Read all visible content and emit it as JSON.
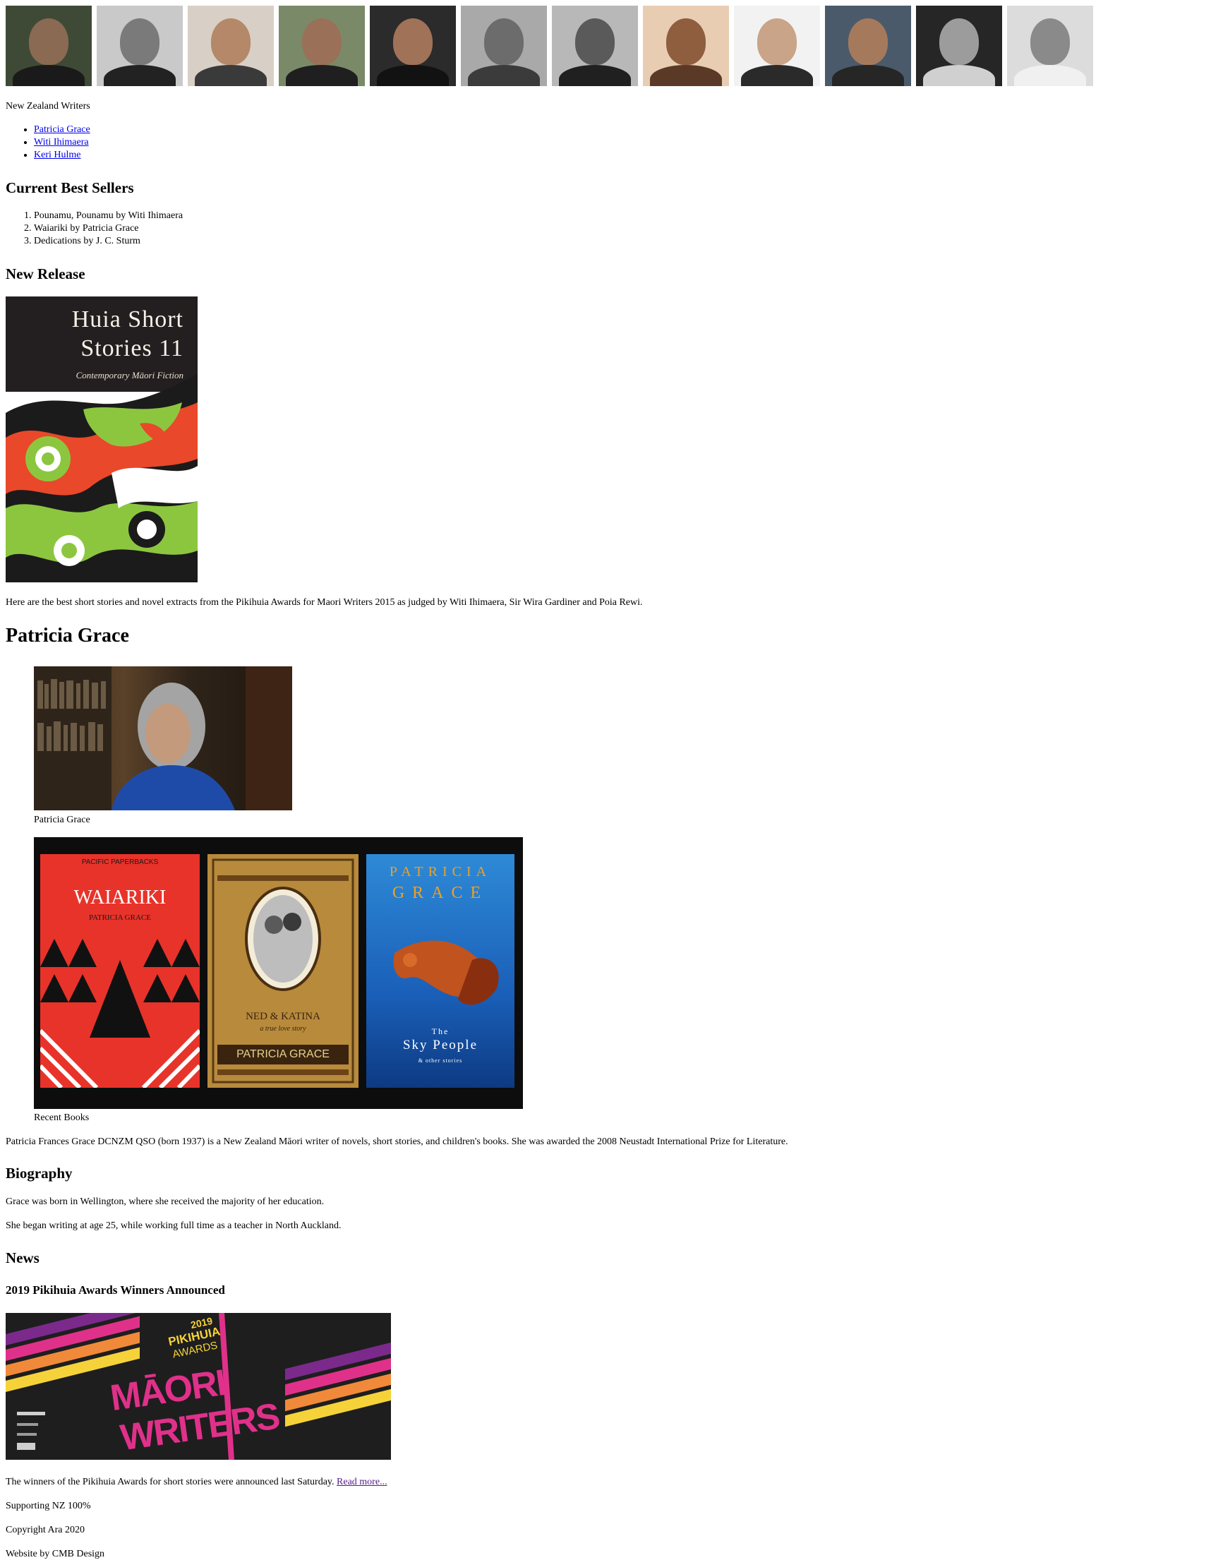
{
  "header": {
    "portraits": [
      {
        "name": "portrait-1",
        "bg": "#3f4a36",
        "skin": "#8a6a52",
        "cloth": "#1a1a1a"
      },
      {
        "name": "portrait-2",
        "bg": "#c9c9c9",
        "skin": "#7a7a7a",
        "cloth": "#222222"
      },
      {
        "name": "portrait-3",
        "bg": "#d8cfc6",
        "skin": "#b48868",
        "cloth": "#3a3a3a"
      },
      {
        "name": "portrait-4",
        "bg": "#7a8a68",
        "skin": "#9a7058",
        "cloth": "#1f1f1f"
      },
      {
        "name": "portrait-5",
        "bg": "#2b2b2b",
        "skin": "#a07258",
        "cloth": "#121212"
      },
      {
        "name": "portrait-6",
        "bg": "#a9a9a9",
        "skin": "#6c6c6c",
        "cloth": "#3b3b3b"
      },
      {
        "name": "portrait-7",
        "bg": "#b8b8b8",
        "skin": "#5a5a5a",
        "cloth": "#202020"
      },
      {
        "name": "portrait-8",
        "bg": "#e8cdb2",
        "skin": "#8e5e3e",
        "cloth": "#5a3a26"
      },
      {
        "name": "portrait-9",
        "bg": "#f2f2f2",
        "skin": "#c9a488",
        "cloth": "#2a2a2a"
      },
      {
        "name": "portrait-10",
        "bg": "#4a5a6a",
        "skin": "#a57a5c",
        "cloth": "#262626"
      },
      {
        "name": "portrait-11",
        "bg": "#262626",
        "skin": "#9c9c9c",
        "cloth": "#d0d0d0"
      },
      {
        "name": "portrait-12",
        "bg": "#dcdcdc",
        "skin": "#8a8a8a",
        "cloth": "#f0f0f0"
      }
    ]
  },
  "site_title": "New Zealand Writers",
  "nav": [
    "Patricia Grace",
    "Witi Ihimaera",
    "Keri Hulme"
  ],
  "bestsellers": {
    "heading": "Current Best Sellers",
    "items": [
      "Pounamu, Pounamu by Witi Ihimaera",
      "Waiariki by Patricia Grace",
      "Dedications by J. C. Sturm"
    ]
  },
  "new_release": {
    "heading": "New Release",
    "cover": {
      "title_line1": "Huia Short",
      "title_line2": "Stories 11",
      "subtitle": "Contemporary Māori Fiction"
    },
    "blurb": "Here are the best short stories and novel extracts from the Pikihuia Awards for Maori Writers 2015 as judged by Witi Ihimaera, Sir Wira Gardiner and Poia Rewi."
  },
  "author": {
    "name": "Patricia Grace",
    "photo_caption": "Patricia Grace",
    "books_caption": "Recent Books",
    "books": [
      {
        "series": "PACIFIC PAPERBACKS",
        "title": "WAIARIKI",
        "author": "PATRICIA GRACE"
      },
      {
        "title": "NED & KATINA",
        "subtitle": "a true love story",
        "author": "PATRICIA GRACE"
      },
      {
        "author_top": "PATRICIA",
        "author_bottom": "GRACE",
        "title_the": "The",
        "title": "Sky People",
        "subtitle": "& other stories"
      }
    ],
    "intro": "Patricia Frances Grace DCNZM QSO (born 1937) is a New Zealand Māori writer of novels, short stories, and children's books. She was awarded the 2008 Neustadt International Prize for Literature.",
    "bio_heading": "Biography",
    "bio": [
      "Grace was born in Wellington, where she received the majority of her education.",
      "She began writing at age 25, while working full time as a teacher in North Auckland."
    ]
  },
  "news": {
    "heading": "News",
    "item_title": "2019 Pikihuia Awards Winners Announced",
    "banner": {
      "year": "2019",
      "line1": "PIKIHUIA",
      "line2": "AWARDS",
      "big1": "MĀORI",
      "big2": "WRITERS"
    },
    "text": "The winners of the Pikihuia Awards for short stories were announced last Saturday.",
    "link": "Read more..."
  },
  "footer": [
    "Supporting NZ 100%",
    "Copyright Ara 2020",
    "Website by CMB Design"
  ],
  "colors": {
    "link": "#0000ee",
    "visited": "#551a8b"
  }
}
